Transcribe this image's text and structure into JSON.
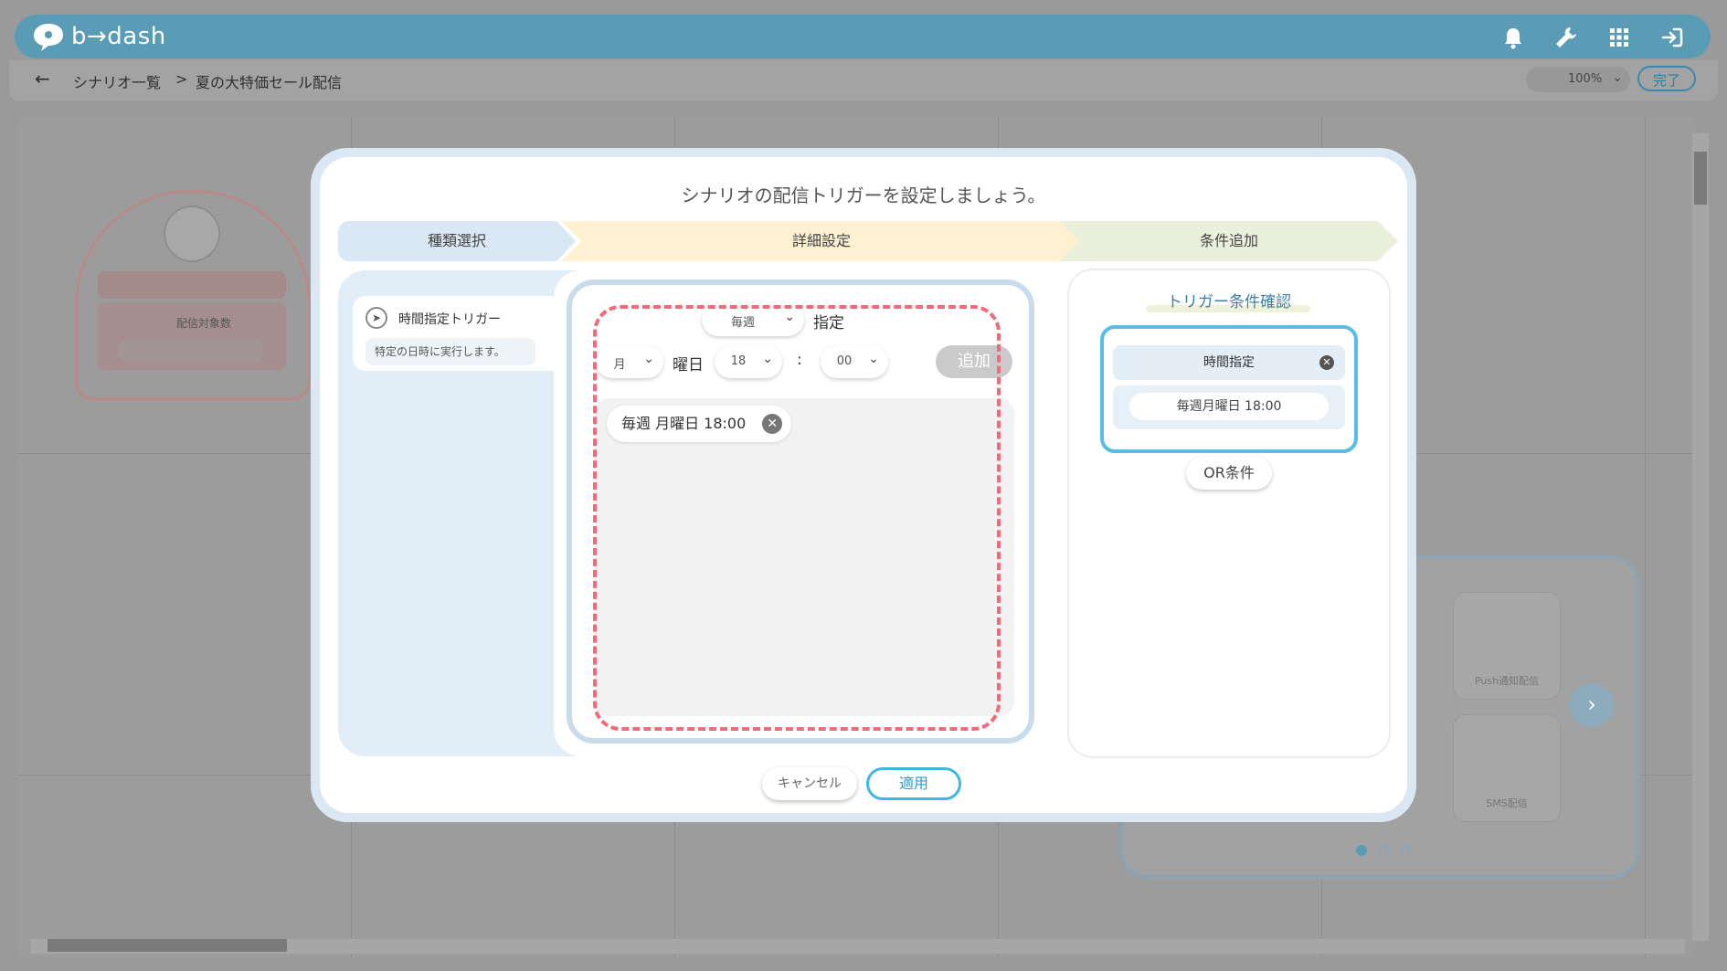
{
  "app": {
    "logo_text": "b→dash"
  },
  "header": {
    "icons": [
      "bell-icon",
      "wrench-icon",
      "grid-icon",
      "logout-icon"
    ]
  },
  "breadcrumb": {
    "back": "←",
    "items": [
      "シナリオ一覧",
      ">",
      "夏の大特価セール配信"
    ]
  },
  "toolbar": {
    "zoom": "100%",
    "done_label": "完了"
  },
  "background": {
    "segment_label": "配信対象数",
    "cards": [
      "Push通知配信",
      "SMS配信"
    ],
    "next_arrow": "›"
  },
  "modal": {
    "title": "シナリオの配信トリガーを設定しましょう。",
    "steps": [
      "種類選択",
      "詳細設定",
      "条件追加"
    ],
    "trigger_type": {
      "name": "時間指定トリガー",
      "description": "特定の日時に実行します。"
    },
    "detail": {
      "frequency": "毎週",
      "frequency_suffix": "指定",
      "weekday": "月",
      "weekday_suffix": "曜日",
      "hour": "18",
      "colon": ":",
      "minute": "00",
      "add_label": "追加",
      "added_items": [
        "毎週 月曜日 18:00"
      ]
    },
    "summary": {
      "title": "トリガー条件確認",
      "condition_title": "時間指定",
      "condition_value": "毎週月曜日 18:00",
      "or_label": "OR条件"
    },
    "cancel_label": "キャンセル",
    "apply_label": "適用"
  },
  "colors": {
    "header": "#5a9cb6",
    "accent": "#3fb6e6",
    "highlight_dash": "#f06b7a"
  }
}
